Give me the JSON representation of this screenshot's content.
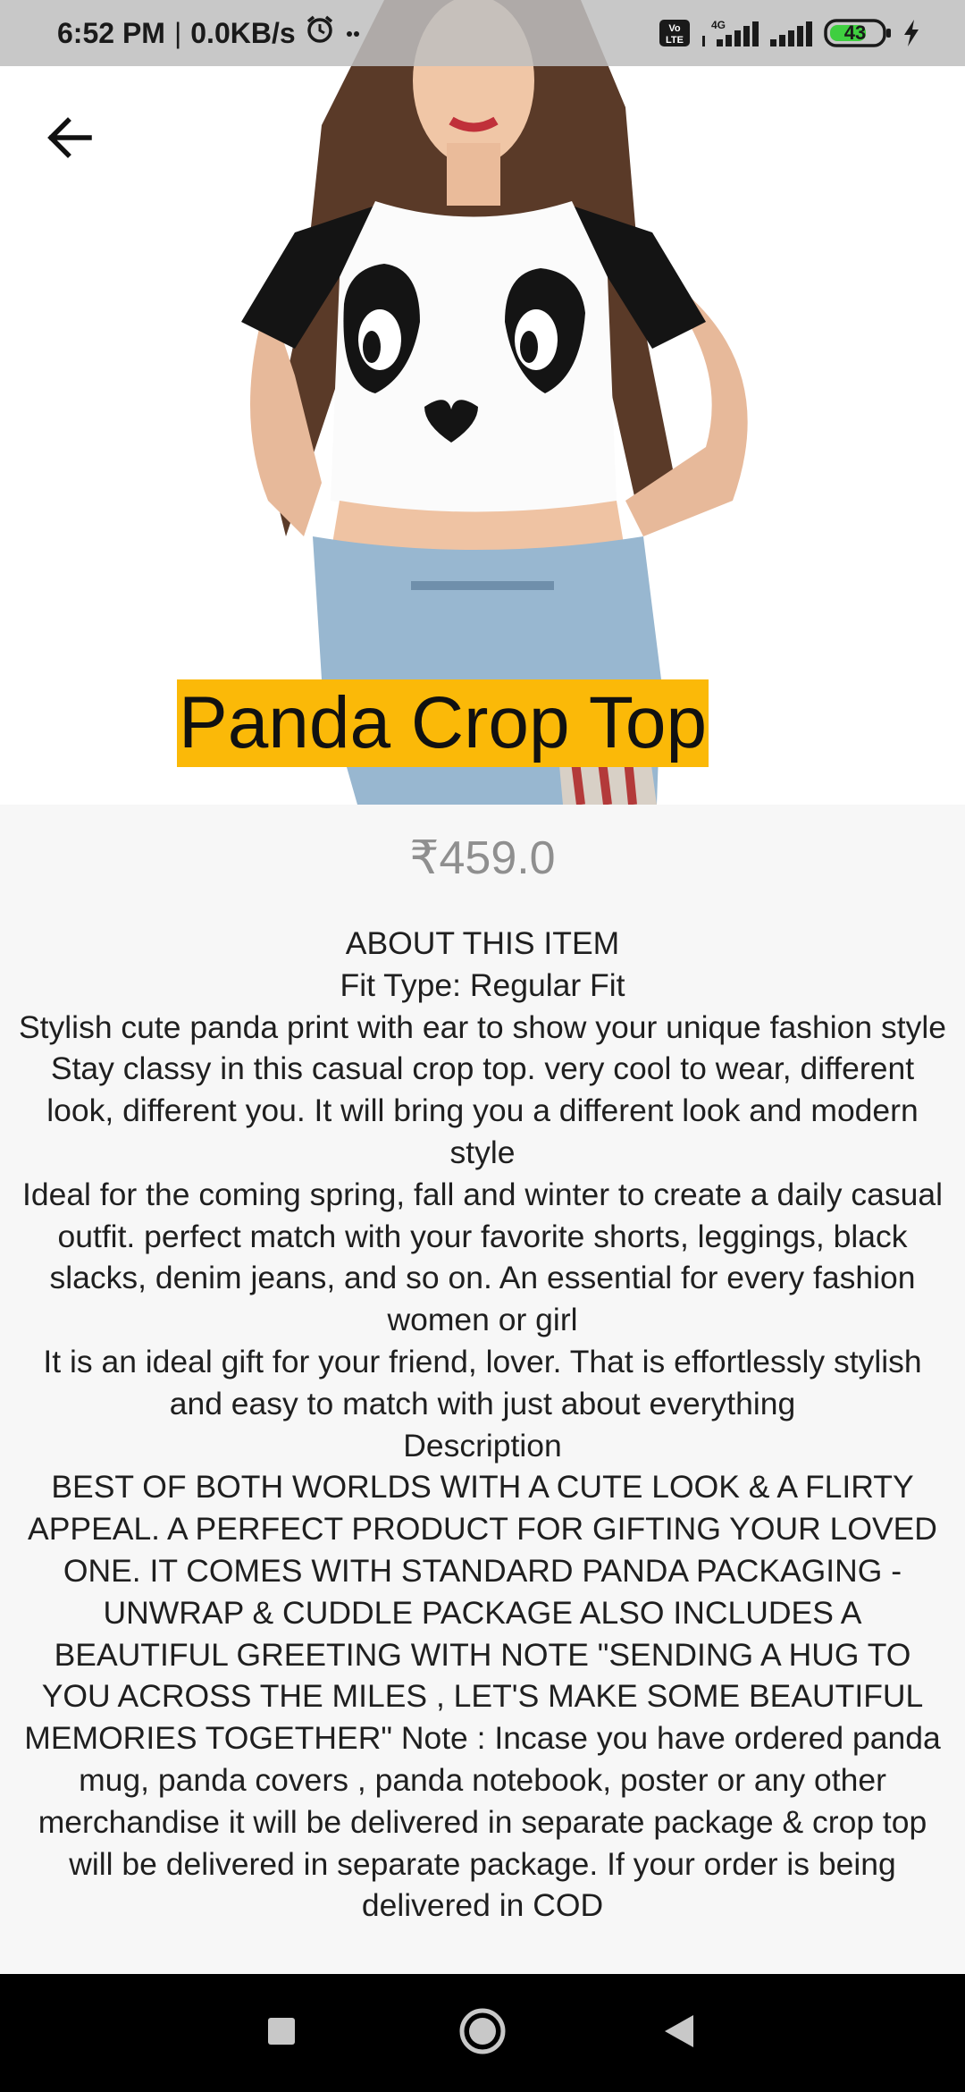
{
  "status_bar": {
    "time": "6:52 PM",
    "separator": "|",
    "net_speed": "0.0KB/s",
    "volte_label": "Vo LTE",
    "network_label": "4G",
    "battery": "43"
  },
  "product": {
    "title": "Panda Crop Top",
    "price": "₹459.0",
    "description_lines": [
      "ABOUT THIS ITEM",
      "Fit Type: Regular Fit",
      "Stylish cute panda print with ear to show your unique fashion style",
      "Stay classy in this casual crop top. very cool to wear, different look, different you. It will bring you a different look and modern style",
      "Ideal for the coming spring, fall and winter to create a daily casual outfit. perfect match with your favorite shorts, leggings, black slacks, denim jeans, and so on. An essential for every fashion women or girl",
      "It is an ideal gift for your friend, lover. That is effortlessly stylish and easy to match with just about everything",
      "Description",
      "BEST OF BOTH WORLDS WITH A CUTE LOOK & A FLIRTY APPEAL. A PERFECT PRODUCT FOR GIFTING YOUR LOVED ONE. IT COMES WITH STANDARD PANDA PACKAGING - UNWRAP & CUDDLE PACKAGE ALSO INCLUDES A BEAUTIFUL GREETING WITH NOTE \"SENDING A HUG TO YOU ACROSS THE MILES , LET'S MAKE SOME BEAUTIFUL MEMORIES TOGETHER\" Note : Incase you have ordered panda mug, panda covers , panda notebook, poster or any other merchandise it will be delivered in separate package & crop top will be delivered in separate package. If your order is being delivered in COD"
    ]
  },
  "colors": {
    "title_highlight": "#fbb908",
    "price_text": "#8f8f8f",
    "nav_bar": "#000000"
  },
  "icons": {
    "back": "arrow-left-icon",
    "alarm": "alarm-icon",
    "signal": "signal-icon",
    "battery": "battery-icon",
    "charging": "lightning-icon",
    "nav_recents": "square-icon",
    "nav_home": "circle-icon",
    "nav_back": "triangle-icon"
  }
}
